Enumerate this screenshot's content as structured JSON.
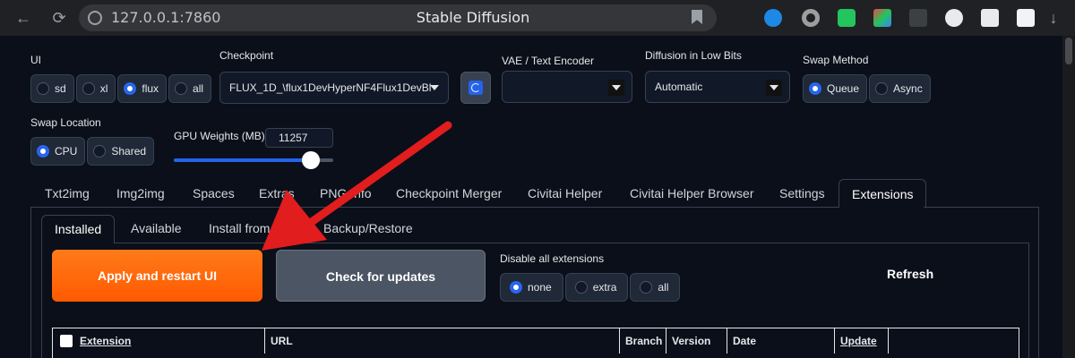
{
  "browser": {
    "url": "127.0.0.1:7860",
    "tab_title": "Stable Diffusion"
  },
  "ui_group": {
    "label": "UI",
    "options": [
      "sd",
      "xl",
      "flux",
      "all"
    ],
    "selected": "flux"
  },
  "checkpoint": {
    "label": "Checkpoint",
    "value": "FLUX_1D_\\flux1DevHyperNF4Flux1DevBl"
  },
  "vae": {
    "label": "VAE / Text Encoder",
    "value": ""
  },
  "diffusion_low_bits": {
    "label": "Diffusion in Low Bits",
    "value": "Automatic"
  },
  "swap_method": {
    "label": "Swap Method",
    "options": [
      "Queue",
      "Async"
    ],
    "selected": "Queue"
  },
  "swap_location": {
    "label": "Swap Location",
    "options": [
      "CPU",
      "Shared"
    ],
    "selected": "CPU"
  },
  "gpu_weights": {
    "label": "GPU Weights (MB)",
    "value": "11257",
    "slider_fraction": 0.86
  },
  "tabs": [
    "Txt2img",
    "Img2img",
    "Spaces",
    "Extras",
    "PNG Info",
    "Checkpoint Merger",
    "Civitai Helper",
    "Civitai Helper Browser",
    "Settings",
    "Extensions"
  ],
  "active_tab": "Extensions",
  "subtabs": [
    "Installed",
    "Available",
    "Install from URL",
    "Backup/Restore"
  ],
  "active_subtab": "Installed",
  "buttons": {
    "apply": "Apply and restart UI",
    "check": "Check for updates",
    "refresh": "Refresh"
  },
  "disable_extensions": {
    "label": "Disable all extensions",
    "options": [
      "none",
      "extra",
      "all"
    ],
    "selected": "none"
  },
  "table": {
    "headers": [
      "Extension",
      "URL",
      "Branch",
      "Version",
      "Date",
      "Update"
    ]
  },
  "colors": {
    "accent": "#2563eb",
    "apply_button": "#ff6a00",
    "annotation_arrow": "#e11d1d"
  }
}
